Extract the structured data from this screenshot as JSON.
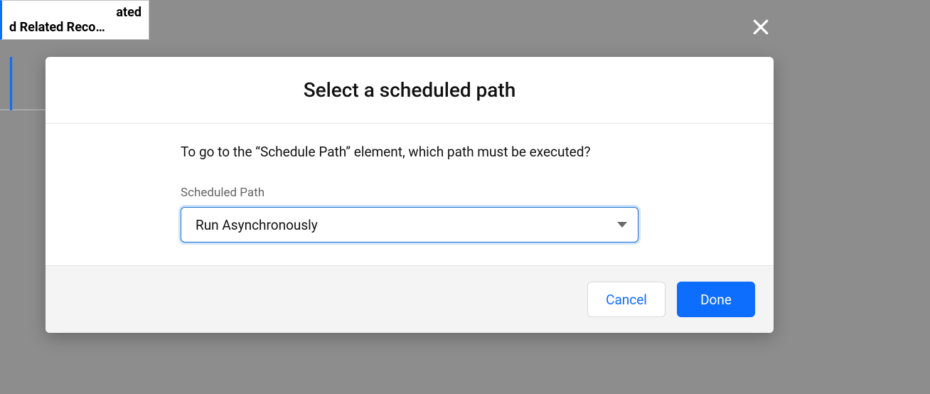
{
  "background": {
    "node_line1_fragment": "ated",
    "node_line2_fragment": "d Related Reco…"
  },
  "modal": {
    "title": "Select a scheduled path",
    "prompt": "To go to the “Schedule Path” element, which path must be executed?",
    "field_label": "Scheduled Path",
    "selected_value": "Run Asynchronously",
    "cancel_label": "Cancel",
    "done_label": "Done"
  }
}
